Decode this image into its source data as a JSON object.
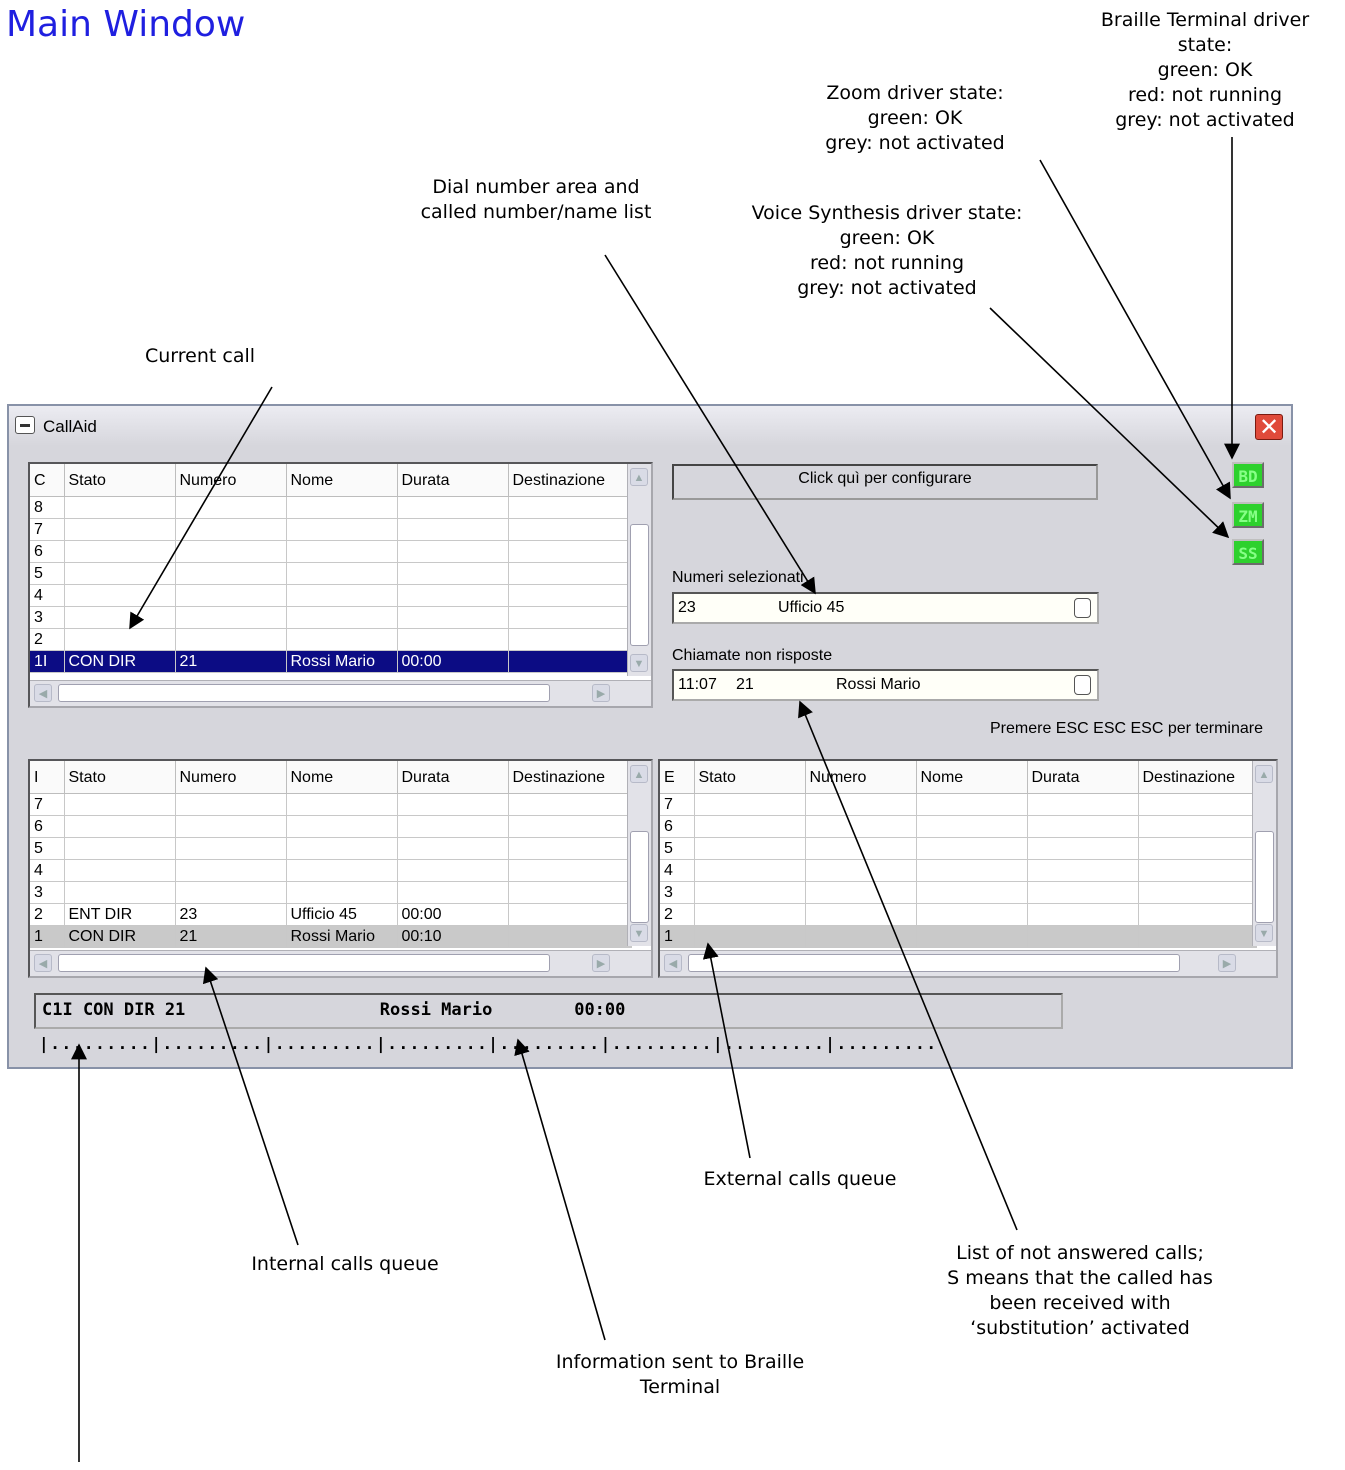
{
  "page_title": "Main Window",
  "annotations": {
    "braille_driver": [
      "Braille Terminal driver",
      "state:",
      "green: OK",
      "red: not running",
      "grey: not activated"
    ],
    "zoom_driver": [
      "Zoom driver state:",
      "green: OK",
      "grey: not activated"
    ],
    "dial_area": [
      "Dial number area and",
      "called number/name list"
    ],
    "voice_driver": [
      "Voice Synthesis driver state:",
      "green: OK",
      "red: not running",
      "grey: not activated"
    ],
    "current_call": [
      "Current call"
    ],
    "external_queue": [
      "External calls queue"
    ],
    "internal_queue": [
      "Internal calls queue"
    ],
    "not_answered": [
      "List of not answered calls;",
      "S means that the called has",
      "been received with",
      "‘substitution’ activated"
    ],
    "braille_info": [
      "Information sent to Braille",
      "Terminal"
    ]
  },
  "window": {
    "title": "CallAid",
    "close_glyph": "✕",
    "config_button": "Click quì per configurare",
    "badges": [
      "BD",
      "ZM",
      "SS"
    ],
    "dialed_label": "Numeri selezionati",
    "dialed_value": {
      "number": "23",
      "name": "Ufficio 45"
    },
    "missed_label": "Chiamate non risposte",
    "missed_value": {
      "time": "11:07",
      "number": "21",
      "name": "Rossi Mario"
    },
    "exit_hint": "Premere ESC ESC ESC per terminare",
    "braille_line": "C1I CON DIR 21                   Rossi Mario        00:00",
    "braille_ruler": "|.........|.........|.........|.........|.........|.........|.........|........."
  },
  "current_grid": {
    "columns": [
      "C",
      "Stato",
      "Numero",
      "Nome",
      "Durata",
      "Destinazione"
    ],
    "rows": [
      [
        "8",
        "",
        "",
        "",
        "",
        ""
      ],
      [
        "7",
        "",
        "",
        "",
        "",
        ""
      ],
      [
        "6",
        "",
        "",
        "",
        "",
        ""
      ],
      [
        "5",
        "",
        "",
        "",
        "",
        ""
      ],
      [
        "4",
        "",
        "",
        "",
        "",
        ""
      ],
      [
        "3",
        "",
        "",
        "",
        "",
        ""
      ],
      [
        "2",
        "",
        "",
        "",
        "",
        ""
      ],
      [
        "1I",
        "CON DIR",
        "21",
        "Rossi Mario",
        "00:00",
        ""
      ]
    ]
  },
  "internal_grid": {
    "columns": [
      "I",
      "Stato",
      "Numero",
      "Nome",
      "Durata",
      "Destinazione"
    ],
    "rows": [
      [
        "7",
        "",
        "",
        "",
        "",
        ""
      ],
      [
        "6",
        "",
        "",
        "",
        "",
        ""
      ],
      [
        "5",
        "",
        "",
        "",
        "",
        ""
      ],
      [
        "4",
        "",
        "",
        "",
        "",
        ""
      ],
      [
        "3",
        "",
        "",
        "",
        "",
        ""
      ],
      [
        "2",
        "ENT DIR",
        "23",
        "Ufficio 45",
        "00:00",
        ""
      ],
      [
        "1",
        "CON DIR",
        "21",
        "Rossi Mario",
        "00:10",
        ""
      ]
    ]
  },
  "external_grid": {
    "columns": [
      "E",
      "Stato",
      "Numero",
      "Nome",
      "Durata",
      "Destinazione"
    ],
    "rows": [
      [
        "7",
        "",
        "",
        "",
        "",
        ""
      ],
      [
        "6",
        "",
        "",
        "",
        "",
        ""
      ],
      [
        "5",
        "",
        "",
        "",
        "",
        ""
      ],
      [
        "4",
        "",
        "",
        "",
        "",
        ""
      ],
      [
        "3",
        "",
        "",
        "",
        "",
        ""
      ],
      [
        "2",
        "",
        "",
        "",
        "",
        ""
      ],
      [
        "1",
        "",
        "",
        "",
        "",
        ""
      ]
    ]
  }
}
